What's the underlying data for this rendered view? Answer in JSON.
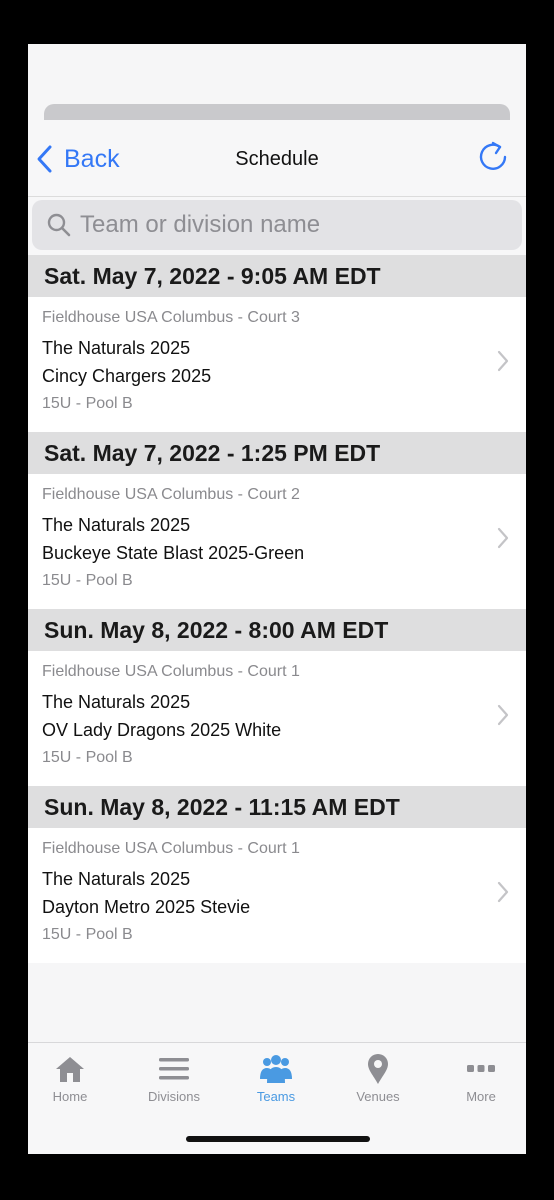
{
  "navbar": {
    "back_label": "Back",
    "title": "Schedule"
  },
  "search": {
    "placeholder": "Team or division name"
  },
  "schedule": [
    {
      "header": "Sat. May 7, 2022 - 9:05 AM EDT",
      "venue": "Fieldhouse USA Columbus - Court 3",
      "team1": "The Naturals 2025",
      "team2": "Cincy Chargers 2025",
      "division": "15U - Pool B"
    },
    {
      "header": "Sat. May 7, 2022 - 1:25 PM EDT",
      "venue": "Fieldhouse USA Columbus - Court 2",
      "team1": "The Naturals 2025",
      "team2": "Buckeye State Blast 2025-Green",
      "division": "15U - Pool B"
    },
    {
      "header": "Sun. May 8, 2022 - 8:00 AM EDT",
      "venue": "Fieldhouse USA Columbus - Court 1",
      "team1": "The Naturals 2025",
      "team2": "OV Lady Dragons 2025 White",
      "division": "15U - Pool B"
    },
    {
      "header": "Sun. May 8, 2022 - 11:15 AM EDT",
      "venue": "Fieldhouse USA Columbus - Court 1",
      "team1": "The Naturals 2025",
      "team2": "Dayton Metro 2025 Stevie",
      "division": "15U - Pool B"
    }
  ],
  "tabbar": {
    "items": [
      {
        "label": "Home",
        "icon": "home-icon"
      },
      {
        "label": "Divisions",
        "icon": "list-icon"
      },
      {
        "label": "Teams",
        "icon": "people-icon",
        "active": true
      },
      {
        "label": "Venues",
        "icon": "map-pin-icon"
      },
      {
        "label": "More",
        "icon": "more-icon"
      }
    ]
  },
  "colors": {
    "accent": "#3478f6",
    "active_tab": "#4a9ae2",
    "inactive_tab": "#8e8e93",
    "section_header_bg": "#dededf"
  }
}
